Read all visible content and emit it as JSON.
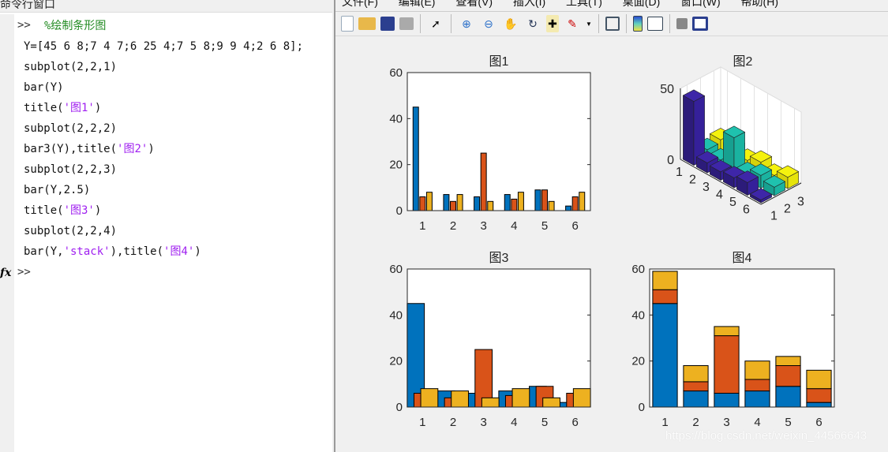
{
  "command_window": {
    "title": "命令行窗口",
    "prompt": ">>",
    "lines": [
      [
        {
          "t": "%绘制条形图",
          "c": "cmt"
        }
      ],
      [
        {
          "t": "Y=[45 6 8;7 4 7;6 25 4;7 5 8;9 9 4;2 6 8];",
          "c": ""
        }
      ],
      [
        {
          "t": "subplot(2,2,1)",
          "c": ""
        }
      ],
      [
        {
          "t": "bar(Y)",
          "c": ""
        }
      ],
      [
        {
          "t": "title(",
          "c": ""
        },
        {
          "t": "'图1'",
          "c": "str"
        },
        {
          "t": ")",
          "c": ""
        }
      ],
      [
        {
          "t": "subplot(2,2,2)",
          "c": ""
        }
      ],
      [
        {
          "t": "bar3(Y),title(",
          "c": ""
        },
        {
          "t": "'图2'",
          "c": "str"
        },
        {
          "t": ")",
          "c": ""
        }
      ],
      [
        {
          "t": "subplot(2,2,3)",
          "c": ""
        }
      ],
      [
        {
          "t": "bar(Y,2.5)",
          "c": ""
        }
      ],
      [
        {
          "t": "title(",
          "c": ""
        },
        {
          "t": "'图3'",
          "c": "str"
        },
        {
          "t": ")",
          "c": ""
        }
      ],
      [
        {
          "t": "subplot(2,2,4)",
          "c": ""
        }
      ],
      [
        {
          "t": "bar(Y,",
          "c": ""
        },
        {
          "t": "'stack'",
          "c": "str"
        },
        {
          "t": "),title(",
          "c": ""
        },
        {
          "t": "'图4'",
          "c": "str"
        },
        {
          "t": ")",
          "c": ""
        }
      ]
    ],
    "fx_label": "fx"
  },
  "figure": {
    "menu": [
      "文件(F)",
      "编辑(E)",
      "查看(V)",
      "插入(I)",
      "工具(T)",
      "桌面(D)",
      "窗口(W)",
      "帮助(H)"
    ],
    "toolbar": [
      "new-figure",
      "open",
      "save",
      "print",
      "select-arrow",
      "zoom-in",
      "zoom-out",
      "pan",
      "rotate-3d",
      "data-cursor",
      "brush",
      "link-plot",
      "colorbar",
      "legend",
      "hide-plot-tools",
      "show-plot-tools"
    ]
  },
  "watermark": "https://blog.csdn.net/weixin_44566643",
  "colors": {
    "s1": "#0072bd",
    "s2": "#d95319",
    "s3": "#edb120",
    "p1": "#3e26a8",
    "p2": "#1fc1ae",
    "p3": "#f5f20e"
  },
  "chart_data": [
    {
      "type": "bar",
      "title": "图1",
      "categories": [
        "1",
        "2",
        "3",
        "4",
        "5",
        "6"
      ],
      "series": [
        {
          "values": [
            45,
            7,
            6,
            7,
            9,
            2
          ]
        },
        {
          "values": [
            6,
            4,
            25,
            5,
            9,
            6
          ]
        },
        {
          "values": [
            8,
            7,
            4,
            8,
            4,
            8
          ]
        }
      ],
      "ylim": [
        0,
        60
      ],
      "yticks": [
        0,
        20,
        40,
        60
      ],
      "bar_width": 0.8,
      "mode": "grouped"
    },
    {
      "type": "bar3",
      "title": "图2",
      "rows": [
        "1",
        "2",
        "3",
        "4",
        "5",
        "6"
      ],
      "cols": [
        "1",
        "2",
        "3"
      ],
      "values": [
        [
          45,
          6,
          8
        ],
        [
          7,
          4,
          7
        ],
        [
          6,
          25,
          4
        ],
        [
          7,
          5,
          8
        ],
        [
          9,
          9,
          4
        ],
        [
          2,
          6,
          8
        ]
      ],
      "zticks": [
        0,
        50
      ]
    },
    {
      "type": "bar",
      "title": "图3",
      "categories": [
        "1",
        "2",
        "3",
        "4",
        "5",
        "6"
      ],
      "series": [
        {
          "values": [
            45,
            7,
            6,
            7,
            9,
            2
          ]
        },
        {
          "values": [
            6,
            4,
            25,
            5,
            9,
            6
          ]
        },
        {
          "values": [
            8,
            7,
            4,
            8,
            4,
            8
          ]
        }
      ],
      "ylim": [
        0,
        60
      ],
      "yticks": [
        0,
        20,
        40,
        60
      ],
      "bar_width": 2.5,
      "mode": "grouped"
    },
    {
      "type": "bar",
      "title": "图4",
      "categories": [
        "1",
        "2",
        "3",
        "4",
        "5",
        "6"
      ],
      "series": [
        {
          "values": [
            45,
            7,
            6,
            7,
            9,
            2
          ]
        },
        {
          "values": [
            6,
            4,
            25,
            5,
            9,
            6
          ]
        },
        {
          "values": [
            8,
            7,
            4,
            8,
            4,
            8
          ]
        }
      ],
      "ylim": [
        0,
        60
      ],
      "yticks": [
        0,
        20,
        40,
        60
      ],
      "bar_width": 0.8,
      "mode": "stacked"
    }
  ]
}
